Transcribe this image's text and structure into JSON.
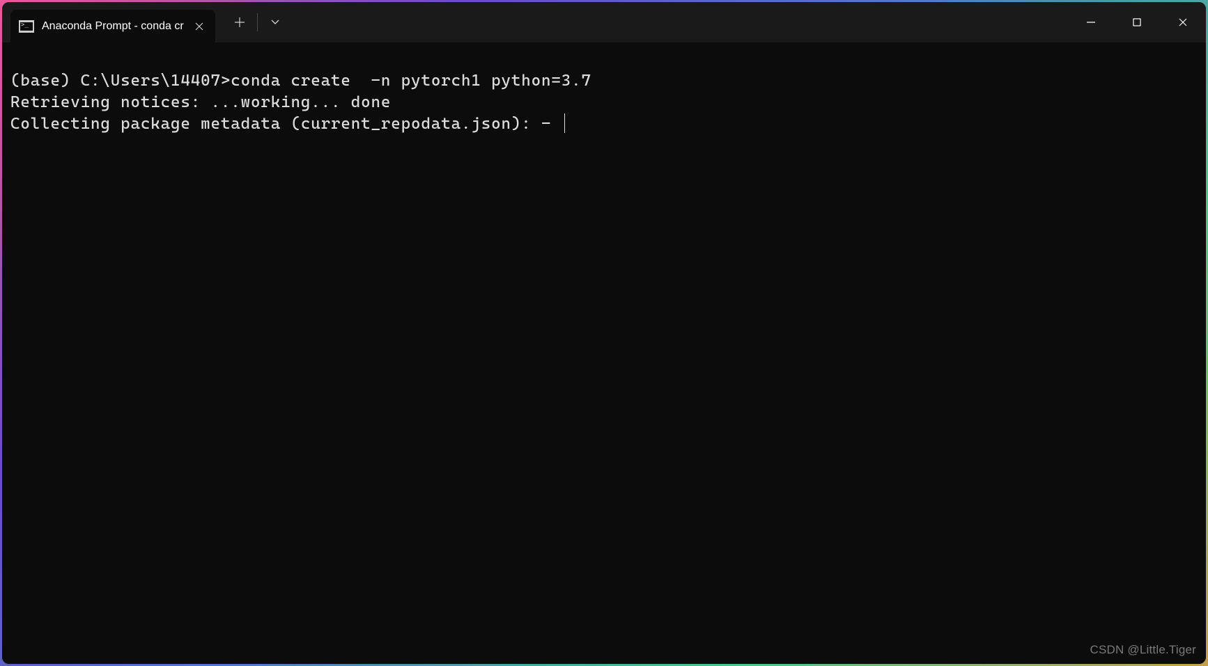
{
  "tab": {
    "title": "Anaconda Prompt - conda  cr"
  },
  "terminal": {
    "line1": "(base) C:\\Users\\14407>conda create  -n pytorch1 python=3.7",
    "line2": "Retrieving notices: ...working... done",
    "line3": "Collecting package metadata (current_repodata.json): - "
  },
  "watermark": "CSDN @Little.Tiger"
}
